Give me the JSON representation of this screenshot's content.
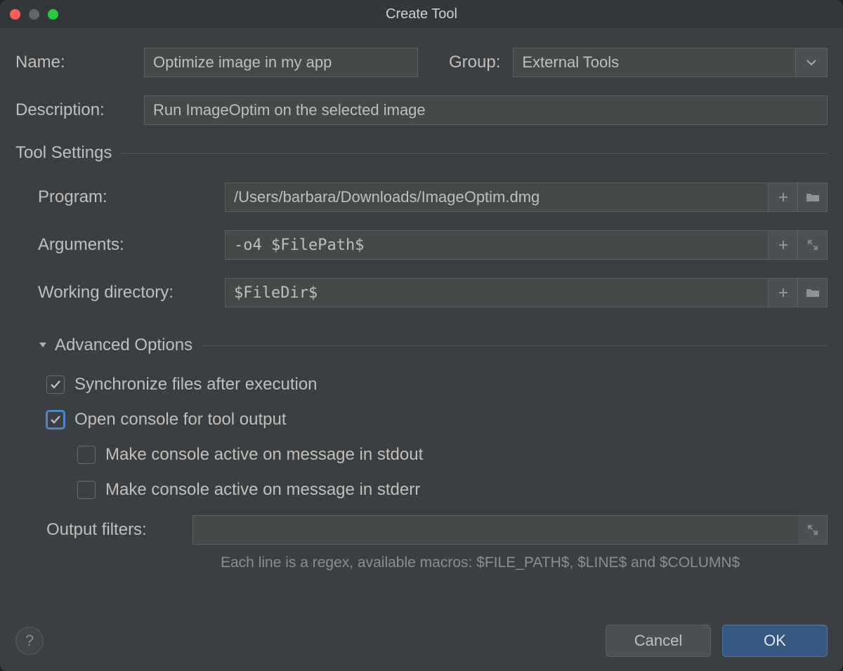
{
  "window": {
    "title": "Create Tool"
  },
  "fields": {
    "name": {
      "label": "Name:",
      "value": "Optimize image in my app"
    },
    "group": {
      "label": "Group:",
      "value": "External Tools"
    },
    "description": {
      "label": "Description:",
      "value": "Run ImageOptim on the selected image"
    }
  },
  "toolSettings": {
    "title": "Tool Settings",
    "program": {
      "label": "Program:",
      "value": "/Users/barbara/Downloads/ImageOptim.dmg"
    },
    "arguments": {
      "label": "Arguments:",
      "value": "-o4 $FilePath$"
    },
    "workingDir": {
      "label": "Working directory:",
      "value": "$FileDir$"
    }
  },
  "advanced": {
    "title": "Advanced Options",
    "syncFiles": {
      "label": "Synchronize files after execution",
      "checked": true
    },
    "openConsole": {
      "label": "Open console for tool output",
      "checked": true,
      "focused": true
    },
    "activeStdout": {
      "label": "Make console active on message in stdout",
      "checked": false
    },
    "activeStderr": {
      "label": "Make console active on message in stderr",
      "checked": false
    },
    "outputFilters": {
      "label": "Output filters:",
      "value": ""
    },
    "hint": "Each line is a regex, available macros: $FILE_PATH$, $LINE$ and $COLUMN$"
  },
  "buttons": {
    "help": "?",
    "cancel": "Cancel",
    "ok": "OK"
  },
  "colors": {
    "accent": "#4a88c7"
  }
}
